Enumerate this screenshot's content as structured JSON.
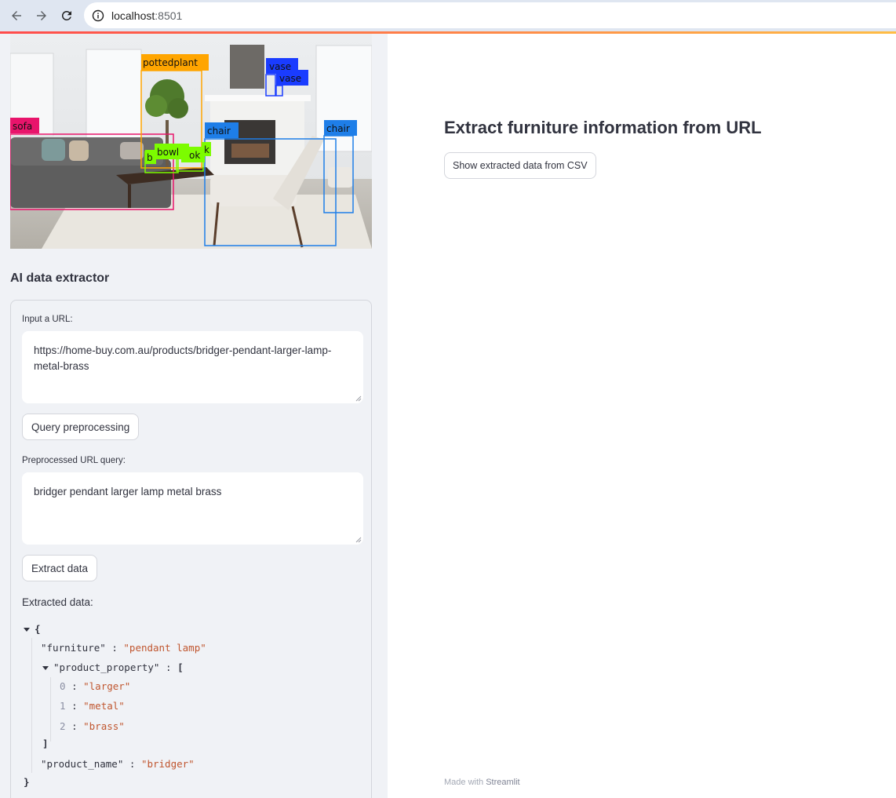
{
  "browser": {
    "url_host": "localhost",
    "url_port": ":8501"
  },
  "sidebar": {
    "scene_labels": {
      "sofa": "sofa",
      "pottedplant": "pottedplant",
      "vase1": "vase",
      "vase2": "vase",
      "chair1": "chair",
      "chair2": "chair",
      "bowl": "bowl",
      "book": "ok",
      "bowl_partial": "b",
      "book_partial": "k"
    },
    "title": "AI data extractor",
    "url_input_label": "Input a URL:",
    "url_input_value": "https://home-buy.com.au/products/bridger-pendant-larger-lamp-metal-brass",
    "preprocess_button": "Query preprocessing",
    "query_label": "Preprocessed URL query:",
    "query_value": "bridger pendant larger lamp metal brass",
    "extract_button": "Extract data",
    "extracted_label": "Extracted data:",
    "json": {
      "open_brace": "{",
      "close_brace": "}",
      "furniture_key": "\"furniture\"",
      "furniture_value": "\"pendant lamp\"",
      "property_key": "\"product_property\"",
      "open_bracket": "[",
      "close_bracket": "]",
      "properties": [
        {
          "index": "0",
          "value": "\"larger\""
        },
        {
          "index": "1",
          "value": "\"metal\""
        },
        {
          "index": "2",
          "value": "\"brass\""
        }
      ],
      "name_key": "\"product_name\"",
      "name_value": "\"bridger\"",
      "colon": ":"
    }
  },
  "main": {
    "title": "Extract furniture information from URL",
    "csv_button": "Show extracted data from CSV",
    "footer_prefix": "Made with",
    "footer_brand": "Streamlit"
  },
  "colors": {
    "accent_start": "#ff4b4b",
    "accent_end": "#ffbd45",
    "json_string": "#c0562f",
    "sofa_box": "#e8146b",
    "pottedplant_box": "#ffa500",
    "vase_box": "#1a3cff",
    "chair_box": "#1e7ee8",
    "bowl_box": "#7cfc00"
  }
}
